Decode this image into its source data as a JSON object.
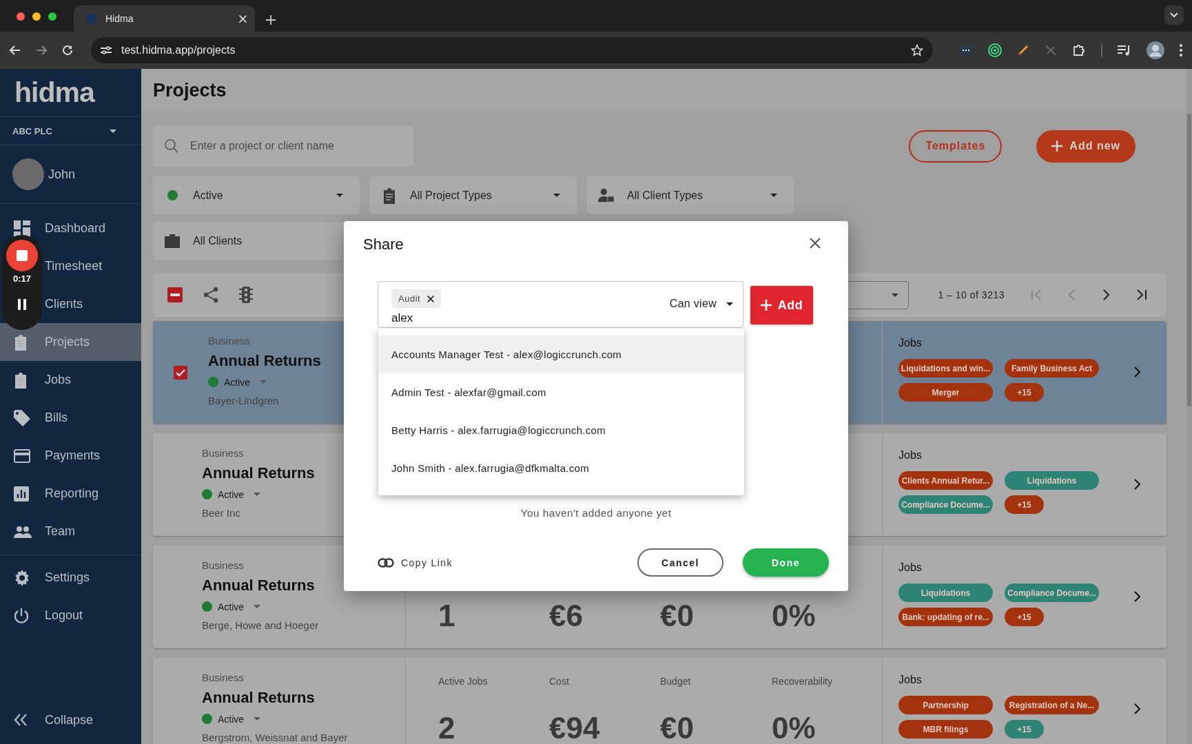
{
  "browser": {
    "tab_title": "Hidma",
    "url": "test.hidma.app/projects"
  },
  "sidebar": {
    "logo": "hidma",
    "org": "ABC PLC",
    "user": "John",
    "items": [
      {
        "label": "Dashboard",
        "selected": false
      },
      {
        "label": "Timesheet",
        "selected": false
      },
      {
        "label": "Clients",
        "selected": false
      },
      {
        "label": "Projects",
        "selected": true
      },
      {
        "label": "Jobs",
        "selected": false
      },
      {
        "label": "Bills",
        "selected": false
      },
      {
        "label": "Payments",
        "selected": false
      },
      {
        "label": "Reporting",
        "selected": false
      },
      {
        "label": "Team",
        "selected": false
      }
    ],
    "footer_items": [
      {
        "label": "Settings"
      },
      {
        "label": "Logout"
      }
    ],
    "collapse": "Collapse"
  },
  "recorder": {
    "time": "0:17"
  },
  "page": {
    "title": "Projects",
    "search": {
      "placeholder": "Enter a project or client name"
    },
    "buttons": [
      {
        "label": "Templates",
        "kind": "outline"
      },
      {
        "label": "Add new",
        "kind": "primary"
      }
    ],
    "filters": [
      {
        "label": "Active"
      },
      {
        "label": "All Project Types"
      },
      {
        "label": "All Client Types"
      },
      {
        "label": "All Clients"
      }
    ],
    "pagination": "1 – 10 of 3213"
  },
  "projects": [
    {
      "type": "Business",
      "name": "Annual Returns",
      "status": "Active",
      "client": "Bayer-Lindgren",
      "selected": true,
      "jobs_label": "Jobs",
      "jobs": [
        {
          "label": "Liquidations and win...",
          "color": "#a3330e"
        },
        {
          "label": "Family Business Act",
          "color": "#a3330e"
        },
        {
          "label": "Merger",
          "color": "#a3330e"
        },
        {
          "label": "+15",
          "color": "#a3330e"
        }
      ]
    },
    {
      "type": "Business",
      "name": "Annual Returns",
      "status": "Active",
      "client": "Beer Inc",
      "selected": false,
      "jobs_label": "Jobs",
      "jobs": [
        {
          "label": "Clients Annual Retur...",
          "color": "#a3330e"
        },
        {
          "label": "Liquidations",
          "color": "#2d8374"
        },
        {
          "label": "Compliance Docume...",
          "color": "#2d8374"
        },
        {
          "label": "+15",
          "color": "#a3330e"
        }
      ]
    },
    {
      "type": "Business",
      "name": "Annual Returns",
      "status": "Active",
      "client": "Berge, Howe and Hoeger",
      "selected": false,
      "stats": [
        {
          "value": "1"
        },
        {
          "value": "€6"
        },
        {
          "value": "€0"
        },
        {
          "value": "0%"
        }
      ],
      "jobs_label": "Jobs",
      "jobs": [
        {
          "label": "Liquidations",
          "color": "#2d8374"
        },
        {
          "label": "Compliance Docume...",
          "color": "#2d8374"
        },
        {
          "label": "Bank: updating of re...",
          "color": "#a3330e"
        },
        {
          "label": "+15",
          "color": "#a3330e"
        }
      ]
    },
    {
      "type": "Business",
      "name": "Annual Returns",
      "status": "Active",
      "client": "Bergstrom, Weissnat and Bayer",
      "selected": false,
      "stats": [
        {
          "label": "Active Jobs",
          "value": "2"
        },
        {
          "label": "Cost",
          "value": "€94"
        },
        {
          "label": "Budget",
          "value": "€0"
        },
        {
          "label": "Recoverability",
          "value": "0%"
        }
      ],
      "jobs_label": "Jobs",
      "jobs": [
        {
          "label": "Partnership",
          "color": "#a3330e"
        },
        {
          "label": "Registration of a Ne...",
          "color": "#a3330e"
        },
        {
          "label": "MBR filings",
          "color": "#a3330e"
        },
        {
          "label": "+15",
          "color": "#2d8374"
        }
      ]
    }
  ],
  "dialog": {
    "title": "Share",
    "chips": [
      {
        "label": "Audit"
      }
    ],
    "input_value": "alex",
    "permission": "Can view",
    "add_label": "Add",
    "options": [
      {
        "label": "Accounts Manager Test - alex@logiccrunch.com",
        "selected": true
      },
      {
        "label": "Admin Test - alexfar@gmail.com",
        "selected": false
      },
      {
        "label": "Betty Harris - alex.farrugia@logiccrunch.com",
        "selected": false
      },
      {
        "label": "John Smith - alex.farrugia@dfkmalta.com",
        "selected": false
      }
    ],
    "empty_note": "You haven't added anyone yet",
    "copy_link": "Copy Link",
    "cancel": "Cancel",
    "done": "Done"
  }
}
